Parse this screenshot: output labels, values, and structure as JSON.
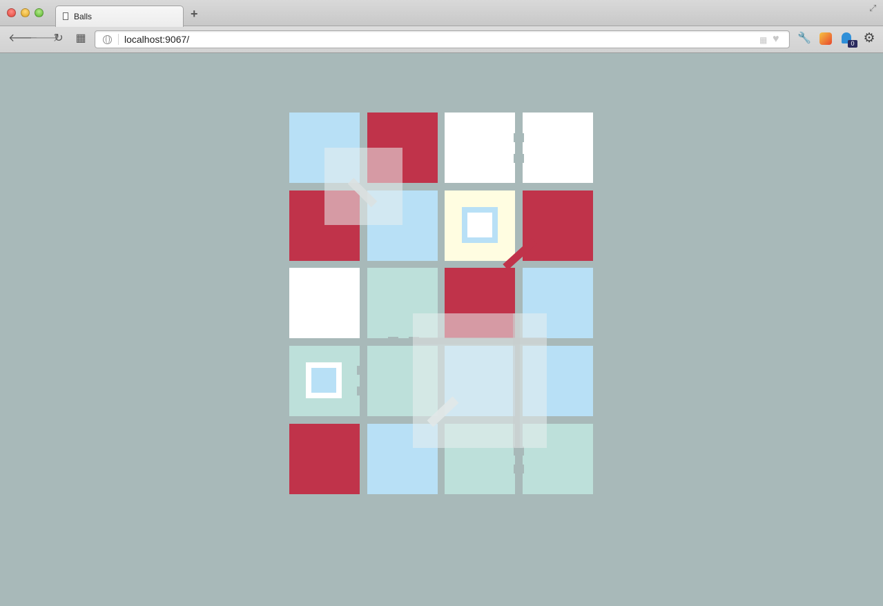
{
  "browser": {
    "tab_title": "Balls",
    "new_tab_symbol": "+",
    "url": "localhost:9067/",
    "back_symbol": "🡐",
    "forward_symbol": "🡒",
    "reload_symbol": "↻",
    "apps_symbol": "▦",
    "fullscreen_symbol": "⤢",
    "wrench_symbol": "🔧",
    "gear_symbol": "⚙",
    "heart_symbol": "♥",
    "grid_symbol": "▦",
    "extension_badge_count": "0"
  },
  "page": {
    "background": "#a8b9b9"
  },
  "board": {
    "rows": 5,
    "columns": 4,
    "colors": {
      "blue": "#b8e0f6",
      "red": "#c0334a",
      "white": "#ffffff",
      "yellow": "#fffde1",
      "green": "#bde0da"
    },
    "cells": [
      [
        "blue",
        "red",
        "white",
        "white"
      ],
      [
        "red",
        "blue",
        "yellow",
        "red"
      ],
      [
        "white",
        "green",
        "red",
        "blue"
      ],
      [
        "green",
        "green",
        "blue",
        "blue"
      ],
      [
        "red",
        "blue",
        "green",
        "green"
      ]
    ],
    "selected_cells": [
      {
        "row": 1,
        "col": 2,
        "frame": "blue",
        "fill": "white"
      },
      {
        "row": 3,
        "col": 0,
        "frame": "white",
        "fill": "blue"
      }
    ]
  }
}
